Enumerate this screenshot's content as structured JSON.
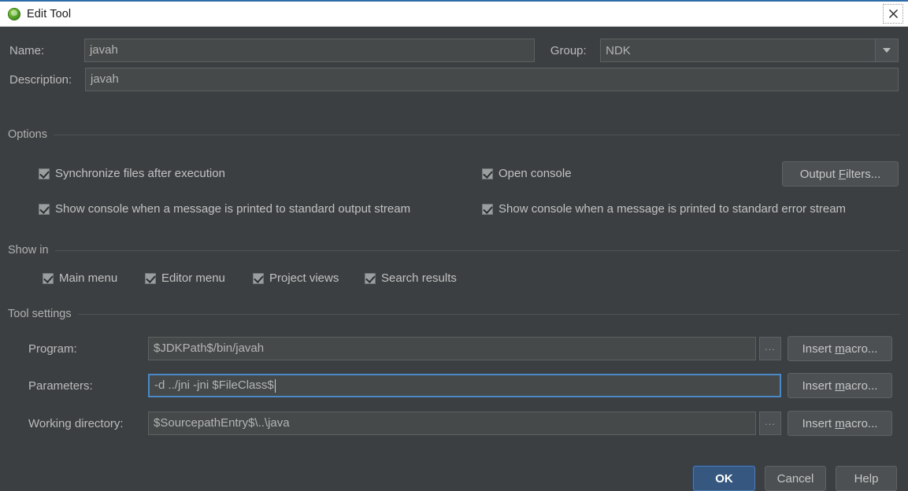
{
  "window": {
    "title": "Edit Tool",
    "icon": "intellij-green-icon",
    "close_icon": "close-icon",
    "accent": "#2d6ca8",
    "background": "#3c3f41"
  },
  "fields": {
    "name_label": "Name:",
    "name_value": "javah",
    "group_label": "Group:",
    "group_value": "NDK",
    "group_dropdown_icon": "chevron-down-icon",
    "description_label": "Description:",
    "description_value": "javah"
  },
  "options": {
    "header": "Options",
    "checkboxes": [
      {
        "label": "Synchronize files after execution",
        "checked": true
      },
      {
        "label": "Open console",
        "checked": true
      },
      {
        "label": "Show console when a message is printed to standard output stream",
        "checked": true
      },
      {
        "label": "Show console when a message is printed to standard error stream",
        "checked": true
      }
    ],
    "output_filters_button": "Output Filters...",
    "output_filters_mnemonic": "F"
  },
  "show_in": {
    "header": "Show in",
    "checkboxes": [
      {
        "label": "Main menu",
        "checked": true
      },
      {
        "label": "Editor menu",
        "checked": true
      },
      {
        "label": "Project views",
        "checked": true
      },
      {
        "label": "Search results",
        "checked": true
      }
    ]
  },
  "tool_settings": {
    "header": "Tool settings",
    "rows": [
      {
        "label": "Program:",
        "value": "$JDKPath$/bin/javah",
        "has_browse": true,
        "browse_label": "...",
        "macro_button": "Insert macro...",
        "focused": false
      },
      {
        "label": "Parameters:",
        "value": "-d ../jni -jni $FileClass$",
        "has_browse": false,
        "browse_label": "",
        "macro_button": "Insert macro...",
        "focused": true
      },
      {
        "label": "Working directory:",
        "value": "$SourcepathEntry$\\..\\java",
        "has_browse": true,
        "browse_label": "...",
        "macro_button": "Insert macro...",
        "focused": false
      }
    ],
    "macro_mnemonic": "m"
  },
  "footer": {
    "ok": "OK",
    "cancel": "Cancel",
    "help": "Help"
  }
}
